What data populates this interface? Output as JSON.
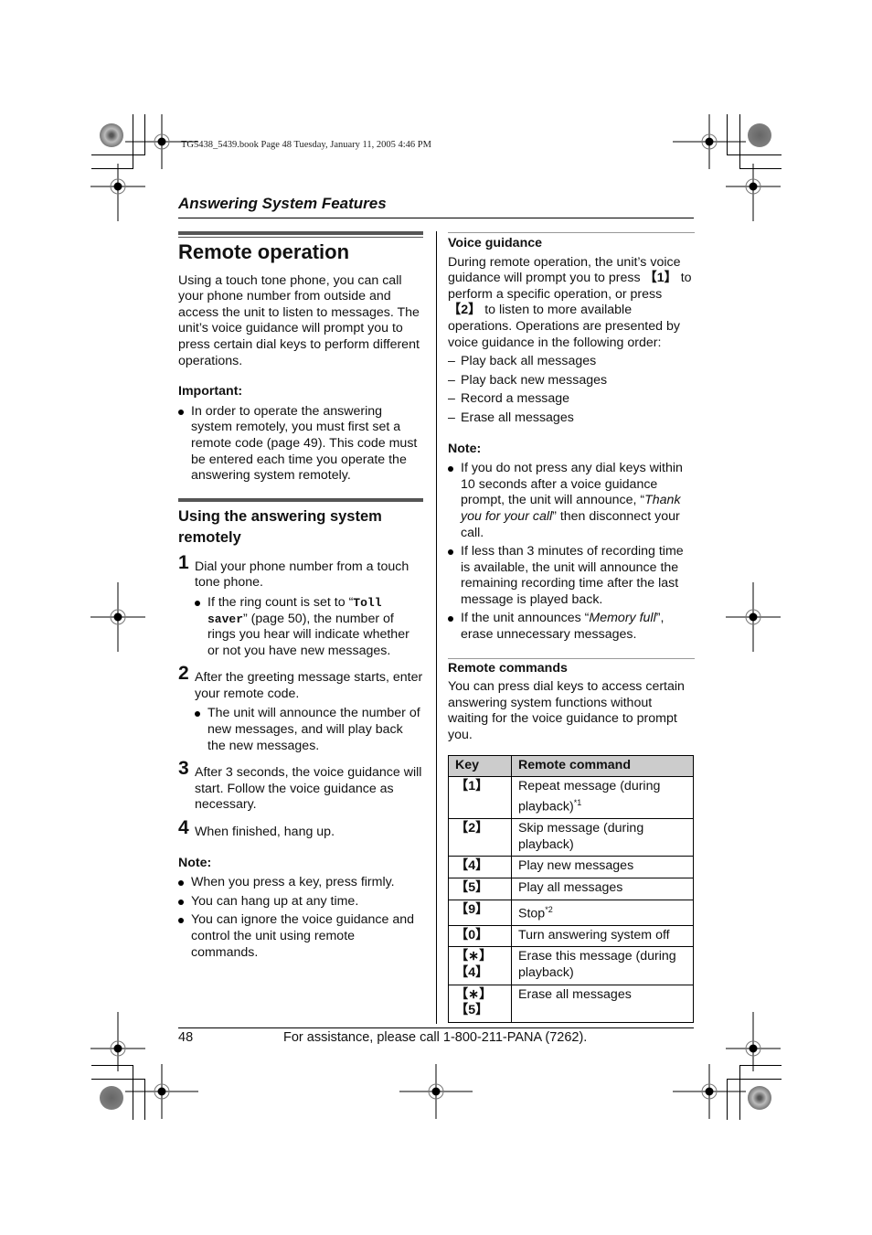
{
  "print_info": "TG5438_5439.book  Page 48  Tuesday, January 11, 2005  4:46 PM",
  "section_header": "Answering System Features",
  "left": {
    "title": "Remote operation",
    "intro": "Using a touch tone phone, you can call your phone number from outside and access the unit to listen to messages. The unit’s voice guidance will prompt you to press certain dial keys to perform different operations.",
    "important_label": "Important:",
    "important_items": [
      "In order to operate the answering system remotely, you must first set a remote code (page 49). This code must be entered each time you operate the answering system remotely."
    ],
    "subheading": "Using the answering system remotely",
    "steps": [
      {
        "num": "1",
        "text": "Dial your phone number from a touch tone phone.",
        "bullet_pre": "If the ring count is set to “",
        "bullet_code": "Toll saver",
        "bullet_post": "” (page 50), the number of rings you hear will indicate whether or not you have new messages."
      },
      {
        "num": "2",
        "text": "After the greeting message starts, enter your remote code.",
        "bullet": "The unit will announce the number of new messages, and will play back the new messages."
      },
      {
        "num": "3",
        "text": "After 3 seconds, the voice guidance will start. Follow the voice guidance as necessary."
      },
      {
        "num": "4",
        "text": "When finished, hang up."
      }
    ],
    "note_label": "Note:",
    "notes": [
      "When you press a key, press firmly.",
      "You can hang up at any time.",
      "You can ignore the voice guidance and control the unit using remote commands."
    ]
  },
  "right": {
    "voice_heading": "Voice guidance",
    "voice_pre": "During remote operation, the unit’s voice guidance will prompt you to press ",
    "voice_key1": "【1】",
    "voice_mid": " to perform a specific operation, or press ",
    "voice_key2": "【2】",
    "voice_post": " to listen to more available operations. Operations are presented by voice guidance in the following order:",
    "order": [
      "Play back all messages",
      "Play back new messages",
      "Record a message",
      "Erase all messages"
    ],
    "note_label": "Note:",
    "note1_pre": "If you do not press any dial keys within 10 seconds after a voice guidance prompt, the unit will announce, “",
    "note1_italic": "Thank you for your call",
    "note1_post": "” then disconnect your call.",
    "note2": "If less than 3 minutes of recording time is available, the unit will announce the remaining recording time after the last message is played back.",
    "note3_pre": "If the unit announces “",
    "note3_italic": "Memory full",
    "note3_post": "”, erase unnecessary messages.",
    "remote_heading": "Remote commands",
    "remote_intro": "You can press dial keys to access certain answering system functions without waiting for the voice guidance to prompt you.",
    "table": {
      "headers": [
        "Key",
        "Remote command"
      ],
      "rows": [
        {
          "key": "【1】",
          "cmd": "Repeat message (during playback)",
          "sup": "*1"
        },
        {
          "key": "【2】",
          "cmd": "Skip message (during playback)",
          "sup": ""
        },
        {
          "key": "【4】",
          "cmd": "Play new messages",
          "sup": ""
        },
        {
          "key": "【5】",
          "cmd": "Play all messages",
          "sup": ""
        },
        {
          "key": "【9】",
          "cmd": "Stop",
          "sup": "*2"
        },
        {
          "key": "【0】",
          "cmd": "Turn answering system off",
          "sup": ""
        },
        {
          "key": "【∗】【4】",
          "cmd": "Erase this message (during playback)",
          "sup": ""
        },
        {
          "key": "【∗】【5】",
          "cmd": "Erase all messages",
          "sup": ""
        }
      ]
    }
  },
  "footer": {
    "page_number": "48",
    "assistance": "For assistance, please call 1-800-211-PANA (7262)."
  }
}
